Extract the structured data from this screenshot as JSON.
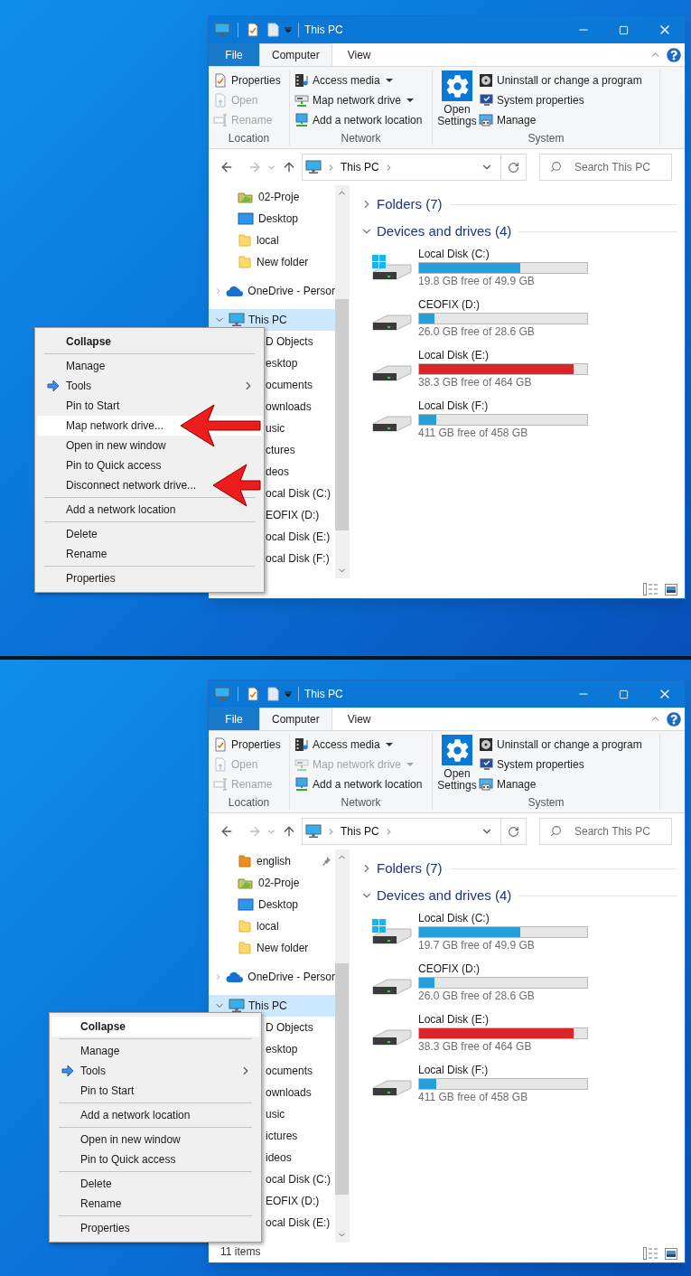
{
  "screens": [
    {
      "title_bar": {
        "title": "This PC"
      },
      "ribbon_tabs": [
        {
          "label": "File",
          "kind": "file",
          "selected": false
        },
        {
          "label": "Computer",
          "kind": "tab",
          "selected": true
        },
        {
          "label": "View",
          "kind": "tab",
          "selected": false
        }
      ],
      "ribbon_groups": [
        {
          "label": "Location",
          "commands": [
            {
              "label": "Properties",
              "kind": "properties",
              "disabled": false,
              "dropdown": false
            },
            {
              "label": "Open",
              "kind": "open",
              "disabled": true,
              "dropdown": false
            },
            {
              "label": "Rename",
              "kind": "rename",
              "disabled": true,
              "dropdown": false
            }
          ]
        },
        {
          "label": "Network",
          "commands": [
            {
              "label": "Access media",
              "kind": "media",
              "disabled": false,
              "dropdown": true
            },
            {
              "label": "Map network drive",
              "kind": "map-drive",
              "disabled": false,
              "dropdown": true
            },
            {
              "label": "Add a network location",
              "kind": "add-location",
              "disabled": false,
              "dropdown": false
            }
          ]
        },
        {
          "label": "System",
          "large_command": {
            "label": "Open Settings"
          },
          "commands": [
            {
              "label": "Uninstall or change a program",
              "kind": "uninstall",
              "disabled": false,
              "dropdown": false
            },
            {
              "label": "System properties",
              "kind": "system",
              "disabled": false,
              "dropdown": false
            },
            {
              "label": "Manage",
              "kind": "manage",
              "disabled": false,
              "dropdown": false
            }
          ]
        }
      ],
      "address": {
        "path": "This PC"
      },
      "search": {
        "placeholder": "Search This PC"
      },
      "nav_items": [
        {
          "label": "02-Proje",
          "kind": "project-folder",
          "pinned": false,
          "selected": false
        },
        {
          "label": "Desktop",
          "kind": "desktop",
          "pinned": false,
          "selected": false
        },
        {
          "label": "local",
          "kind": "folder",
          "pinned": false,
          "selected": false
        },
        {
          "label": "New folder",
          "kind": "folder",
          "pinned": false,
          "selected": false
        },
        {
          "label": "OneDrive - Persor",
          "kind": "onedrive",
          "expanded": false,
          "selected": false
        },
        {
          "label": "This PC",
          "kind": "pc",
          "expanded": true,
          "selected": true,
          "children": [
            {
              "label": "D Objects"
            },
            {
              "label": "esktop"
            },
            {
              "label": "ocuments"
            },
            {
              "label": "ownloads"
            },
            {
              "label": "usic"
            },
            {
              "label": "ctures"
            },
            {
              "label": "deos"
            },
            {
              "label": "ocal Disk (C:)"
            },
            {
              "label": "EOFIX (D:)"
            },
            {
              "label": "ocal Disk (E:)"
            },
            {
              "label": "ocal Disk (F:)"
            }
          ]
        }
      ],
      "context_menu": [
        {
          "label": "Collapse",
          "kind": "item",
          "bold": true,
          "selected": false,
          "pointed": false
        },
        {
          "kind": "separator"
        },
        {
          "label": "Manage",
          "kind": "item",
          "bold": false,
          "selected": false,
          "pointed": false
        },
        {
          "label": "Tools",
          "kind": "submenu",
          "bold": false,
          "selected": false,
          "pointed": false
        },
        {
          "label": "Pin to Start",
          "kind": "item",
          "bold": false,
          "selected": false,
          "pointed": false
        },
        {
          "label": "Map network drive...",
          "kind": "item",
          "bold": false,
          "selected": true,
          "pointed": true
        },
        {
          "label": "Open in new window",
          "kind": "item",
          "bold": false,
          "selected": false,
          "pointed": false
        },
        {
          "label": "Pin to Quick access",
          "kind": "item",
          "bold": false,
          "selected": false,
          "pointed": false
        },
        {
          "label": "Disconnect network drive...",
          "kind": "item",
          "bold": false,
          "selected": false,
          "pointed": true
        },
        {
          "kind": "separator"
        },
        {
          "label": "Add a network location",
          "kind": "item",
          "bold": false,
          "selected": false,
          "pointed": false
        },
        {
          "kind": "separator"
        },
        {
          "label": "Delete",
          "kind": "item",
          "bold": false,
          "selected": false,
          "pointed": false
        },
        {
          "label": "Rename",
          "kind": "item",
          "bold": false,
          "selected": false,
          "pointed": false
        },
        {
          "kind": "separator"
        },
        {
          "label": "Properties",
          "kind": "item",
          "bold": false,
          "selected": false,
          "pointed": false
        }
      ],
      "groups": [
        {
          "label": "Folders (7)",
          "expanded": false
        },
        {
          "label": "Devices and drives (4)",
          "expanded": true,
          "drives": [
            {
              "name": "Local Disk (C:)",
              "free": "19.8 GB free of 49.9 GB",
              "level": 0.6,
              "color": "#26a0da",
              "system": true
            },
            {
              "name": "CEOFIX (D:)",
              "free": "26.0 GB free of 28.6 GB",
              "level": 0.09,
              "color": "#26a0da",
              "system": false
            },
            {
              "name": "Local Disk (E:)",
              "free": "38.3 GB free of 464 GB",
              "level": 0.92,
              "color": "#da2626",
              "system": false
            },
            {
              "name": "Local Disk (F:)",
              "free": "411 GB free of 458 GB",
              "level": 0.1,
              "color": "#26a0da",
              "system": false
            }
          ]
        }
      ]
    },
    {
      "title_bar": {
        "title": "This PC"
      },
      "ribbon_tabs": [
        {
          "label": "File",
          "kind": "file",
          "selected": false
        },
        {
          "label": "Computer",
          "kind": "tab",
          "selected": true
        },
        {
          "label": "View",
          "kind": "tab",
          "selected": false
        }
      ],
      "ribbon_groups": [
        {
          "label": "Location",
          "commands": [
            {
              "label": "Properties",
              "kind": "properties",
              "disabled": false,
              "dropdown": false
            },
            {
              "label": "Open",
              "kind": "open",
              "disabled": true,
              "dropdown": false
            },
            {
              "label": "Rename",
              "kind": "rename",
              "disabled": true,
              "dropdown": false
            }
          ]
        },
        {
          "label": "Network",
          "commands": [
            {
              "label": "Access media",
              "kind": "media",
              "disabled": false,
              "dropdown": true
            },
            {
              "label": "Map network drive",
              "kind": "map-drive",
              "disabled": true,
              "dropdown": true
            },
            {
              "label": "Add a network location",
              "kind": "add-location",
              "disabled": false,
              "dropdown": false
            }
          ]
        },
        {
          "label": "System",
          "large_command": {
            "label": "Open Settings"
          },
          "commands": [
            {
              "label": "Uninstall or change a program",
              "kind": "uninstall",
              "disabled": false,
              "dropdown": false
            },
            {
              "label": "System properties",
              "kind": "system",
              "disabled": false,
              "dropdown": false
            },
            {
              "label": "Manage",
              "kind": "manage",
              "disabled": false,
              "dropdown": false
            }
          ]
        }
      ],
      "address": {
        "path": "This PC"
      },
      "search": {
        "placeholder": "Search This PC"
      },
      "nav_items": [
        {
          "label": "english",
          "kind": "orange-folder",
          "pinned": true,
          "selected": false
        },
        {
          "label": "02-Proje",
          "kind": "project-folder",
          "pinned": false,
          "selected": false
        },
        {
          "label": "Desktop",
          "kind": "desktop",
          "pinned": false,
          "selected": false
        },
        {
          "label": "local",
          "kind": "folder",
          "pinned": false,
          "selected": false
        },
        {
          "label": "New folder",
          "kind": "folder",
          "pinned": false,
          "selected": false
        },
        {
          "label": "OneDrive - Persor",
          "kind": "onedrive",
          "expanded": false,
          "selected": false
        },
        {
          "label": "This PC",
          "kind": "pc",
          "expanded": true,
          "selected": true,
          "children": [
            {
              "label": "D Objects"
            },
            {
              "label": "esktop"
            },
            {
              "label": "ocuments"
            },
            {
              "label": "ownloads"
            },
            {
              "label": "usic"
            },
            {
              "label": "ictures"
            },
            {
              "label": "ideos"
            },
            {
              "label": "ocal Disk (C:)"
            },
            {
              "label": "EOFIX (D:)"
            },
            {
              "label": "ocal Disk (E:)"
            }
          ]
        }
      ],
      "context_menu": [
        {
          "label": "Collapse",
          "kind": "item",
          "bold": true,
          "selected": true,
          "pointed": false
        },
        {
          "kind": "separator"
        },
        {
          "label": "Manage",
          "kind": "item",
          "bold": false,
          "selected": false,
          "pointed": false
        },
        {
          "label": "Tools",
          "kind": "submenu",
          "bold": false,
          "selected": false,
          "pointed": false
        },
        {
          "label": "Pin to Start",
          "kind": "item",
          "bold": false,
          "selected": false,
          "pointed": false
        },
        {
          "kind": "separator"
        },
        {
          "label": "Add a network location",
          "kind": "item",
          "bold": false,
          "selected": false,
          "pointed": false
        },
        {
          "kind": "separator"
        },
        {
          "label": "Open in new window",
          "kind": "item",
          "bold": false,
          "selected": false,
          "pointed": false
        },
        {
          "label": "Pin to Quick access",
          "kind": "item",
          "bold": false,
          "selected": false,
          "pointed": false
        },
        {
          "kind": "separator"
        },
        {
          "label": "Delete",
          "kind": "item",
          "bold": false,
          "selected": false,
          "pointed": false
        },
        {
          "label": "Rename",
          "kind": "item",
          "bold": false,
          "selected": false,
          "pointed": false
        },
        {
          "kind": "separator"
        },
        {
          "label": "Properties",
          "kind": "item",
          "bold": false,
          "selected": false,
          "pointed": false
        }
      ],
      "groups": [
        {
          "label": "Folders (7)",
          "expanded": false
        },
        {
          "label": "Devices and drives (4)",
          "expanded": true,
          "drives": [
            {
              "name": "Local Disk (C:)",
              "free": "19.7 GB free of 49.9 GB",
              "level": 0.6,
              "color": "#26a0da",
              "system": true
            },
            {
              "name": "CEOFIX (D:)",
              "free": "26.0 GB free of 28.6 GB",
              "level": 0.09,
              "color": "#26a0da",
              "system": false
            },
            {
              "name": "Local Disk (E:)",
              "free": "38.3 GB free of 464 GB",
              "level": 0.92,
              "color": "#da2626",
              "system": false
            },
            {
              "name": "Local Disk (F:)",
              "free": "411 GB free of 458 GB",
              "level": 0.1,
              "color": "#26a0da",
              "system": false
            }
          ]
        }
      ],
      "status_bar": {
        "item_count": "11 items"
      }
    }
  ]
}
